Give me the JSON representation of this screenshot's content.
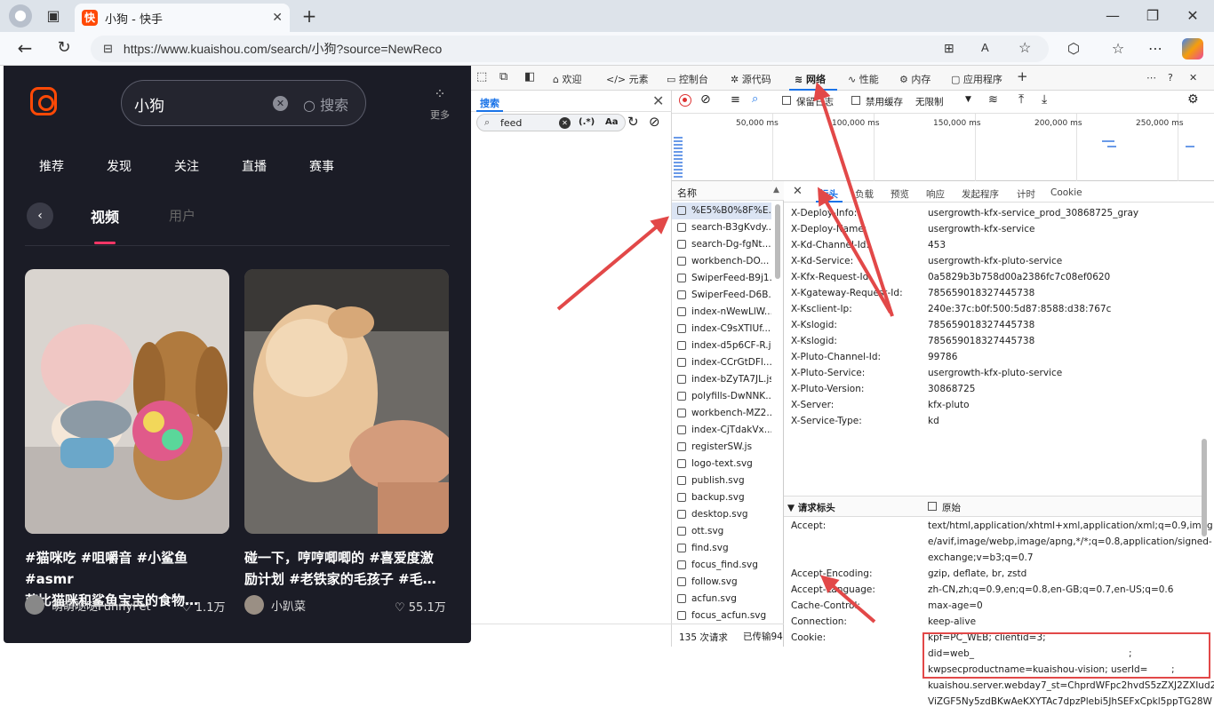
{
  "browser": {
    "tab_title": "小狗 - 快手",
    "tab_favicon": "快",
    "url": "https://www.kuaishou.com/search/小狗?source=NewReco",
    "icons": [
      "profile-icon",
      "tabs-icon",
      "close-icon",
      "new-tab-icon",
      "minimize-icon",
      "restore-icon",
      "window-close-icon",
      "back-icon",
      "reload-icon",
      "site-info-icon",
      "extensions-icon",
      "favorites-icon",
      "more-icon",
      "copilot-icon"
    ]
  },
  "page": {
    "search_value": "小狗",
    "search_button": "搜索",
    "more_label": "更多",
    "nav": [
      "推荐",
      "发现",
      "关注",
      "直播",
      "赛事"
    ],
    "tabs": {
      "video": "视频",
      "user": "用户"
    },
    "cards": [
      {
        "title_line1": "#猫咪吃 #咀嚼音 #小鲨鱼 #asmr",
        "title_line2": "芭比猫咪和鲨鱼宝宝的食物…",
        "author": "萌萌哒哒FunnyPet",
        "likes": "♡ 1.1万"
      },
      {
        "title_line1": "碰一下，哼哼唧唧的 #喜爱度激",
        "title_line2": "励计划 #老铁家的毛孩子 #毛…",
        "author": "小趴菜",
        "likes": "♡ 55.1万"
      }
    ],
    "accent": "#ff4906",
    "underline_color": "#fe3666"
  },
  "devtools": {
    "tabs": [
      "欢迎",
      "元素",
      "控制台",
      "源代码",
      "网络",
      "性能",
      "内存",
      "应用程序"
    ],
    "active_tab": "网络",
    "search_panel": {
      "title": "搜索",
      "query": "feed",
      "regex": "(.*)",
      "case": "Aa"
    },
    "toolbar": {
      "preserve_log": "保留日志",
      "disable_cache": "禁用缓存",
      "throttle": "无限制"
    },
    "timeline": [
      "50,000 ms",
      "100,000 ms",
      "150,000 ms",
      "200,000 ms",
      "250,000 ms"
    ],
    "request_list": {
      "header": "名称",
      "items": [
        "%E5%B0%8F%E...",
        "search-B3gKvdy...",
        "search-Dg-fgNt...",
        "workbench-DO...",
        "SwiperFeed-B9j1...",
        "SwiperFeed-D6B...",
        "index-nWewLlW...",
        "index-C9sXTIUf...",
        "index-d5p6CF-R.js",
        "index-CCrGtDFl...",
        "index-bZyTA7JL.js",
        "polyfills-DwNNK...",
        "workbench-MZ2...",
        "index-CjTdakVx...",
        "registerSW.js",
        "logo-text.svg",
        "publish.svg",
        "backup.svg",
        "desktop.svg",
        "ott.svg",
        "find.svg",
        "focus_find.svg",
        "follow.svg",
        "acfun.svg",
        "focus_acfun.svg"
      ],
      "footer": "135 次请求",
      "transfer": "已传输94"
    },
    "detail": {
      "tabs": [
        "标头",
        "负载",
        "预览",
        "响应",
        "发起程序",
        "计时",
        "Cookie"
      ],
      "response_headers": [
        {
          "k": "X-Deploy-Info:",
          "v": "usergrowth-kfx-service_prod_30868725_gray"
        },
        {
          "k": "X-Deploy-Name:",
          "v": "usergrowth-kfx-service"
        },
        {
          "k": "X-Kd-Channel-Id:",
          "v": "453"
        },
        {
          "k": "X-Kd-Service:",
          "v": "usergrowth-kfx-pluto-service"
        },
        {
          "k": "X-Kfx-Request-Id:",
          "v": "0a5829b3b758d00a2386fc7c08ef0620"
        },
        {
          "k": "X-Kgateway-Request-Id:",
          "v": "785659018327445738"
        },
        {
          "k": "X-Ksclient-Ip:",
          "v": "240e:37c:b0f:500:5d87:8588:d38:767c"
        },
        {
          "k": "X-Kslogid:",
          "v": "785659018327445738"
        },
        {
          "k": "X-Kslogid:",
          "v": "785659018327445738"
        },
        {
          "k": "X-Pluto-Channel-Id:",
          "v": "99786"
        },
        {
          "k": "X-Pluto-Service:",
          "v": "usergrowth-kfx-pluto-service"
        },
        {
          "k": "X-Pluto-Version:",
          "v": "30868725"
        },
        {
          "k": "X-Server:",
          "v": "kfx-pluto"
        },
        {
          "k": "X-Service-Type:",
          "v": "kd"
        }
      ],
      "request_section": "▼ 请求标头",
      "raw_label": "原始",
      "request_headers": {
        "accept_k": "Accept:",
        "accept_v1": "text/html,application/xhtml+xml,application/xml;q=0.9,imag",
        "accept_v2": "e/avif,image/webp,image/apng,*/*;q=0.8,application/signed-",
        "accept_v3": "exchange;v=b3;q=0.7",
        "enc_k": "Accept-Encoding:",
        "enc_v": "gzip, deflate, br, zstd",
        "lang_k": "Accept-Language:",
        "lang_v": "zh-CN,zh;q=0.9,en;q=0.8,en-GB;q=0.7,en-US;q=0.6",
        "cache_k": "Cache-Control:",
        "cache_v": "max-age=0",
        "conn_k": "Connection:",
        "conn_v": "keep-alive",
        "cookie_k": "Cookie:",
        "cookie_v1": "kpf=PC_WEB; clientid=3;",
        "cookie_v2": "did=web_",
        "cookie_v2_end": ";",
        "cookie_v3": "kwpsecproductname=kuaishou-vision; userId=",
        "cookie_v3_end": ";",
        "cookie_v4": "kuaishou.server.webday7_st=ChprdWFpc2hvdS5zZXJ2ZXIud2",
        "cookie_v5": "ViZGF5Ny5zdBKwAeKXYTAc7dpzPlebi5JhSEFxCpkl5ppTG28W"
      }
    },
    "highlight_color": "#e24848"
  }
}
